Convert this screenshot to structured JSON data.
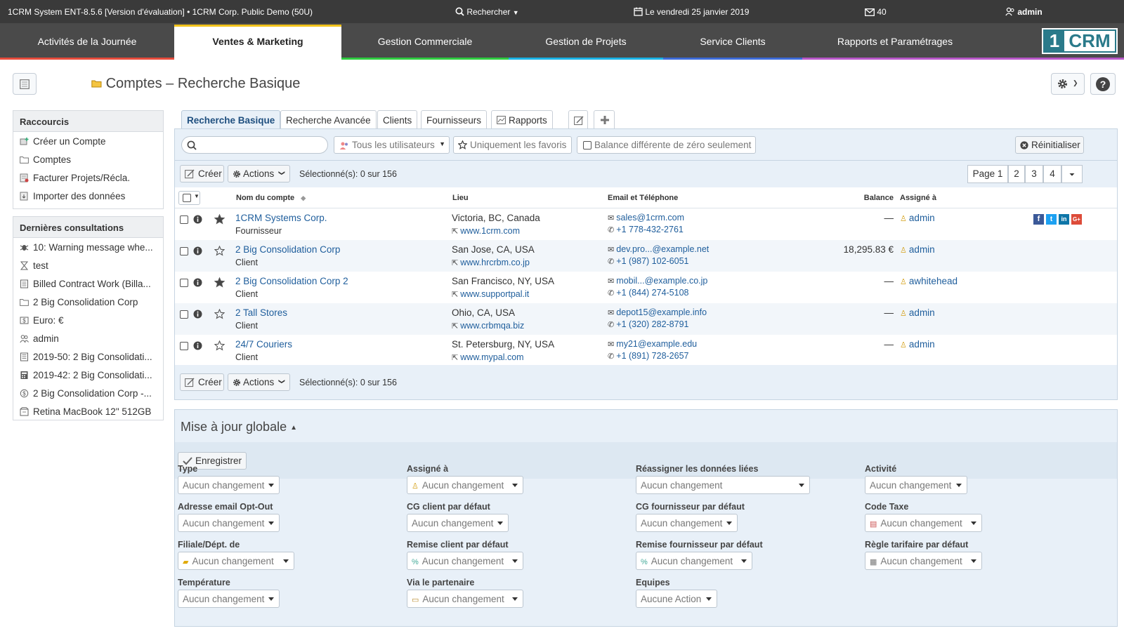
{
  "topbar": {
    "system_title": "1CRM System ENT-8.5.6 [Version d'évaluation] • 1CRM Corp. Public Demo (50U)",
    "search_label": "Rechercher",
    "date_label": "Le vendredi 25 janvier 2019",
    "mail_count": "40",
    "user_label": "admin"
  },
  "nav": {
    "tabs": [
      {
        "label": "Activités de la Journée",
        "color": "#e74c3c"
      },
      {
        "label": "Ventes & Marketing",
        "color": "#f2c21a"
      },
      {
        "label": "Gestion Commerciale",
        "color": "#2ecc40"
      },
      {
        "label": "Gestion de Projets",
        "color": "#1ab3e6"
      },
      {
        "label": "Service Clients",
        "color": "#3d6bd8"
      },
      {
        "label": "Rapports et Paramétrages",
        "color": "#b857c9"
      }
    ],
    "logo_one": "1",
    "logo_crm": "CRM"
  },
  "page": {
    "title": "Comptes",
    "title_dash": " – ",
    "title_sub": "Recherche Basique"
  },
  "sidebar": {
    "shortcuts_title": "Raccourcis",
    "shortcuts": [
      {
        "label": "Créer un Compte",
        "icon": "create-account-icon"
      },
      {
        "label": "Comptes",
        "icon": "folder-icon"
      },
      {
        "label": "Facturer Projets/Récla.",
        "icon": "invoice-icon"
      },
      {
        "label": "Importer des données",
        "icon": "import-icon"
      }
    ],
    "recent_title": "Dernières consultations",
    "recent": [
      {
        "label": "10: Warning message whe...",
        "icon": "bug-icon"
      },
      {
        "label": "test",
        "icon": "hourglass-icon"
      },
      {
        "label": "Billed Contract Work (Billa...",
        "icon": "contract-icon"
      },
      {
        "label": "2 Big Consolidation Corp",
        "icon": "folder-icon"
      },
      {
        "label": "Euro: €",
        "icon": "currency-icon"
      },
      {
        "label": "admin",
        "icon": "users-icon"
      },
      {
        "label": "2019-50: 2 Big Consolidati...",
        "icon": "document-icon"
      },
      {
        "label": "2019-42: 2 Big Consolidati...",
        "icon": "calculator-icon"
      },
      {
        "label": "2 Big Consolidation Corp -...",
        "icon": "coins-icon"
      },
      {
        "label": "Retina MacBook 12\" 512GB",
        "icon": "product-icon"
      }
    ]
  },
  "tabs": {
    "basic": "Recherche Basique",
    "advanced": "Recherche Avancée",
    "clients": "Clients",
    "suppliers": "Fournisseurs",
    "reports": "Rapports"
  },
  "filters": {
    "search_placeholder": "",
    "all_users": "Tous les utilisateurs",
    "favorites": "Uniquement les favoris",
    "nonzero": "Balance différente de zéro seulement",
    "reset": "Réinitialiser"
  },
  "list": {
    "create_label": "Créer",
    "actions_label": "Actions",
    "selected_label": "Sélectionné(s): 0 sur 156",
    "page_label": "Page 1",
    "pages": [
      "2",
      "3",
      "4"
    ],
    "columns": {
      "name": "Nom du compte",
      "location": "Lieu",
      "contact": "Email et Téléphone",
      "balance": "Balance",
      "assigned": "Assigné à"
    },
    "rows": [
      {
        "name": "1CRM Systems Corp.",
        "type": "Fournisseur",
        "location": "Victoria, BC, Canada",
        "website": "www.1crm.com",
        "email": "sales@1crm.com",
        "phone": "+1 778-432-2761",
        "balance": "—",
        "assigned": "admin",
        "starred": true,
        "social": true
      },
      {
        "name": "2 Big Consolidation Corp",
        "type": "Client",
        "location": "San Jose, CA, USA",
        "website": "www.hrcrbm.co.jp",
        "email": "dev.pro...@example.net",
        "phone": "+1 (987) 102-6051",
        "balance": "18,295.83 €",
        "assigned": "admin",
        "starred": false,
        "social": false
      },
      {
        "name": "2 Big Consolidation Corp 2",
        "type": "Client",
        "location": "San Francisco, NY, USA",
        "website": "www.supportpal.it",
        "email": "mobil...@example.co.jp",
        "phone": "+1 (844) 274-5108",
        "balance": "—",
        "assigned": "awhitehead",
        "starred": true,
        "social": false
      },
      {
        "name": "2 Tall Stores",
        "type": "Client",
        "location": "Ohio, CA, USA",
        "website": "www.crbmqa.biz",
        "email": "depot15@example.info",
        "phone": "+1 (320) 282-8791",
        "balance": "—",
        "assigned": "admin",
        "starred": false,
        "social": false
      },
      {
        "name": "24/7 Couriers",
        "type": "Client",
        "location": "St. Petersburg, NY, USA",
        "website": "www.mypal.com",
        "email": "my21@example.edu",
        "phone": "+1 (891) 728-2657",
        "balance": "—",
        "assigned": "admin",
        "starred": false,
        "social": false
      }
    ]
  },
  "massupdate": {
    "title": "Mise à jour globale",
    "save_label": "Enregistrer",
    "fields": [
      {
        "label": "Type",
        "value": "Aucun changement",
        "icon": ""
      },
      {
        "label": "Assigné à",
        "value": "Aucun changement",
        "icon": "user-icon"
      },
      {
        "label": "Réassigner les données liées",
        "value": "Aucun changement",
        "icon": ""
      },
      {
        "label": "Activité",
        "value": "Aucun changement",
        "icon": ""
      },
      {
        "label": "Adresse email Opt-Out",
        "value": "Aucun changement",
        "icon": ""
      },
      {
        "label": "CG client par défaut",
        "value": "Aucun changement",
        "icon": ""
      },
      {
        "label": "CG fournisseur par défaut",
        "value": "Aucun changement",
        "icon": ""
      },
      {
        "label": "Code Taxe",
        "value": "Aucun changement",
        "icon": "tax-icon"
      },
      {
        "label": "Filiale/Dépt. de",
        "value": "Aucun changement",
        "icon": "folder-icon"
      },
      {
        "label": "Remise client par défaut",
        "value": "Aucun changement",
        "icon": "percent-icon"
      },
      {
        "label": "Remise fournisseur par défaut",
        "value": "Aucun changement",
        "icon": "percent-icon"
      },
      {
        "label": "Règle tarifaire par défaut",
        "value": "Aucun changement",
        "icon": "price-rule-icon"
      },
      {
        "label": "Température",
        "value": "Aucun changement",
        "icon": ""
      },
      {
        "label": "Via le partenaire",
        "value": "Aucun changement",
        "icon": "partner-icon"
      },
      {
        "label": "Equipes",
        "value": "Aucune Action",
        "icon": ""
      }
    ]
  }
}
